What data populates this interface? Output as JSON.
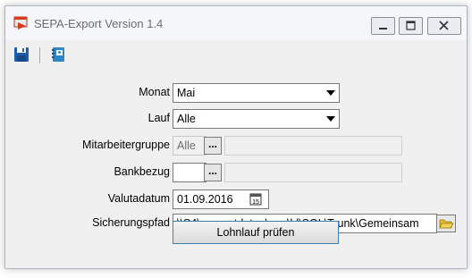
{
  "window": {
    "title": "SEPA-Export Version 1.4",
    "controls": {
      "minimize": "minimize",
      "maximize": "maximize",
      "close": "close"
    }
  },
  "toolbar": {
    "items": [
      {
        "icon": "save-icon"
      },
      {
        "icon": "book-icon"
      }
    ]
  },
  "form": {
    "monat": {
      "label": "Monat",
      "value": "Mai"
    },
    "lauf": {
      "label": "Lauf",
      "value": "Alle"
    },
    "mitarbeitergruppe": {
      "label": "Mitarbeitergruppe",
      "value": "Alle",
      "button": "..."
    },
    "bankbezug": {
      "label": "Bankbezug",
      "value": "",
      "button": "..."
    },
    "valutadatum": {
      "label": "Valutadatum",
      "value": "01.09.2016"
    },
    "sicherungspfad": {
      "label": "Sicherungspfad",
      "value": "\\\\S4\\supportdaten\\app\\bl\\SQL\\Trunk\\Gemeinsam"
    }
  },
  "actions": {
    "pruefen_label": "Lohnlauf prüfen"
  },
  "colors": {
    "accent": "#3c7fb1",
    "save_blue": "#1f5ea8",
    "title_red": "#d83a1f"
  }
}
